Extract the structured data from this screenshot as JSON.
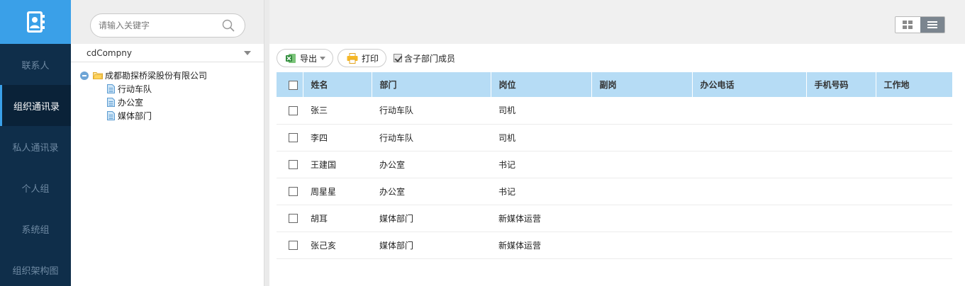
{
  "nav": {
    "items": [
      {
        "label": "联系人",
        "active": false
      },
      {
        "label": "组织通讯录",
        "active": true
      },
      {
        "label": "私人通讯录",
        "active": false
      },
      {
        "label": "个人组",
        "active": false
      },
      {
        "label": "系统组",
        "active": false
      },
      {
        "label": "组织架构图",
        "active": false
      }
    ]
  },
  "search": {
    "placeholder": "请输入关键字",
    "value": ""
  },
  "company_select": {
    "value": "cdCompny"
  },
  "tree": {
    "root": "成都勘探桥梁股份有限公司",
    "children": [
      "行动车队",
      "办公室",
      "媒体部门"
    ]
  },
  "toolbar": {
    "export_label": "导出",
    "print_label": "打印",
    "include_sub_label": "含子部门成员",
    "include_sub_checked": true
  },
  "table": {
    "columns": [
      "姓名",
      "部门",
      "岗位",
      "副岗",
      "办公电话",
      "手机号码",
      "工作地"
    ],
    "rows": [
      [
        "张三",
        "行动车队",
        "司机",
        "",
        "",
        "",
        ""
      ],
      [
        "李四",
        "行动车队",
        "司机",
        "",
        "",
        "",
        ""
      ],
      [
        "王建国",
        "办公室",
        "书记",
        "",
        "",
        "",
        ""
      ],
      [
        "周星星",
        "办公室",
        "书记",
        "",
        "",
        "",
        ""
      ],
      [
        "胡耳",
        "媒体部门",
        "新媒体运营",
        "",
        "",
        "",
        ""
      ],
      [
        "张己亥",
        "媒体部门",
        "新媒体运营",
        "",
        "",
        "",
        ""
      ]
    ]
  },
  "icons": {
    "logo": "contact-book-icon",
    "search": "search-icon",
    "export": "excel-icon",
    "print": "printer-icon",
    "grid_view": "grid-view-icon",
    "list_view": "list-view-icon"
  },
  "colors": {
    "accent": "#3aa0e8",
    "nav_bg": "#0f2e4a",
    "header_row": "#b6dcf5"
  }
}
